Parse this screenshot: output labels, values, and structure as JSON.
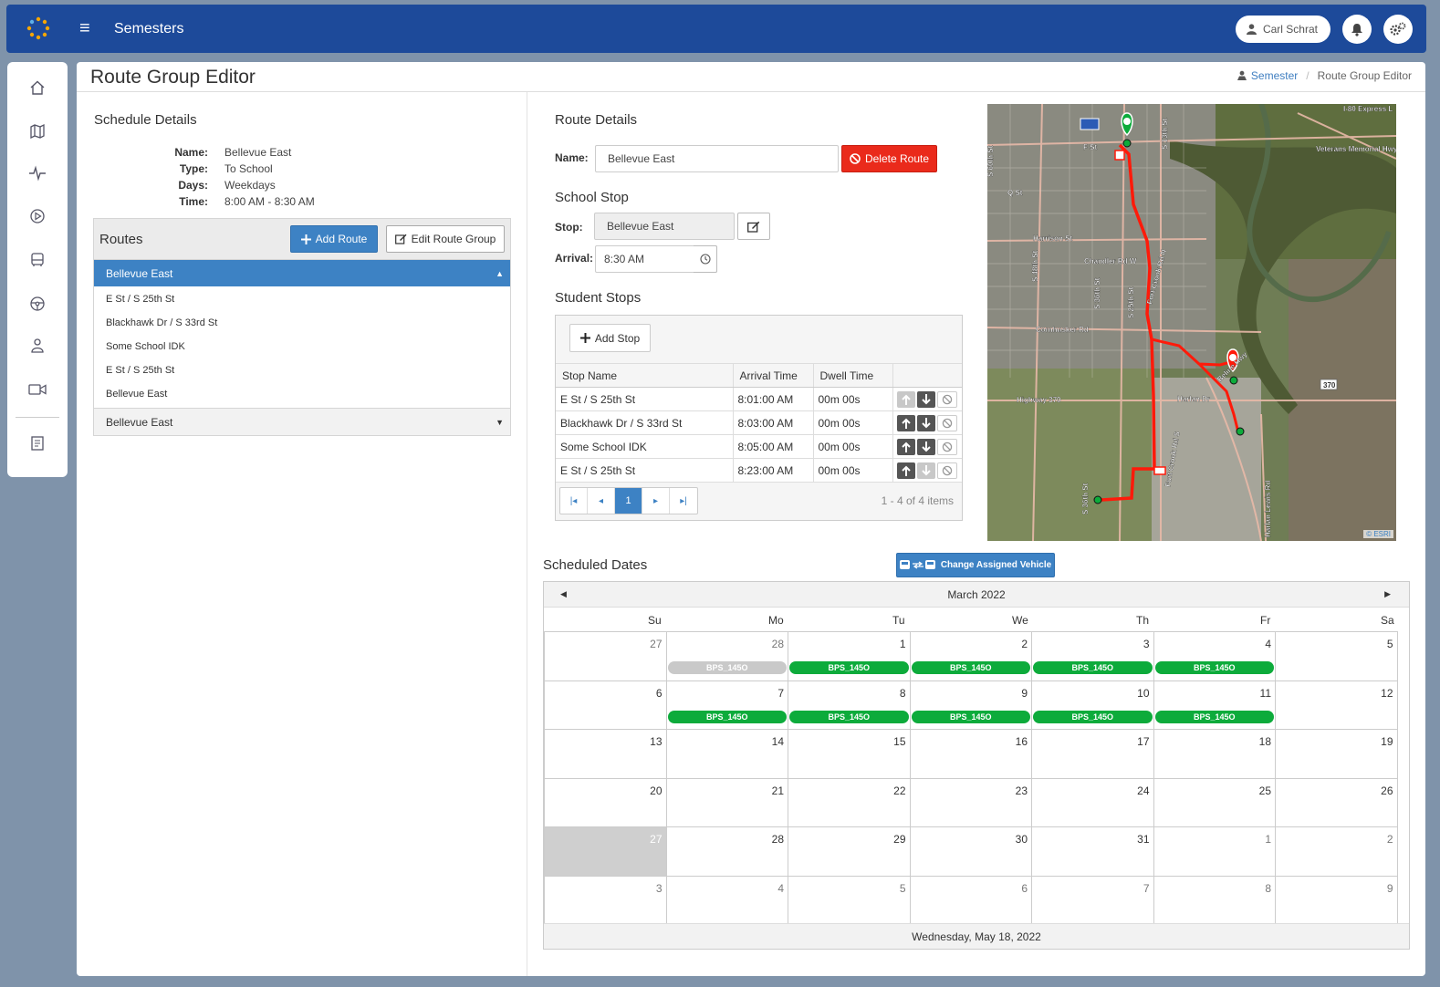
{
  "header": {
    "title": "Semesters",
    "user_name": "Carl Schrat"
  },
  "sidebar": {
    "items": [
      {
        "name": "home-icon"
      },
      {
        "name": "map-icon"
      },
      {
        "name": "activity-icon"
      },
      {
        "name": "play-circle-icon"
      },
      {
        "name": "bus-icon"
      },
      {
        "name": "steering-wheel-icon"
      },
      {
        "name": "person-icon"
      },
      {
        "name": "video-camera-icon"
      },
      {
        "name": "book-icon"
      }
    ]
  },
  "page": {
    "title": "Route Group Editor",
    "breadcrumb": {
      "parent": "Semester",
      "current": "Route Group Editor"
    }
  },
  "schedule": {
    "heading": "Schedule Details",
    "fields": [
      {
        "label": "Name:",
        "value": "Bellevue East"
      },
      {
        "label": "Type:",
        "value": "To School"
      },
      {
        "label": "Days:",
        "value": "Weekdays"
      },
      {
        "label": "Time:",
        "value": "8:00 AM - 8:30 AM"
      }
    ]
  },
  "routes": {
    "heading": "Routes",
    "add_label": "Add Route",
    "edit_label": "Edit Route Group",
    "active_route": "Bellevue East",
    "stops": [
      "E St / S 25th St",
      "Blackhawk Dr / S 33rd St",
      "Some School IDK",
      "E St / S 25th St",
      "Bellevue East"
    ],
    "collapsed_route": "Bellevue East"
  },
  "route_details": {
    "heading": "Route Details",
    "name_label": "Name:",
    "name_value": "Bellevue East",
    "delete_label": "Delete Route"
  },
  "school_stop": {
    "heading": "School Stop",
    "stop_label": "Stop:",
    "stop_value": "Bellevue East",
    "arrival_label": "Arrival:",
    "arrival_value": "8:30 AM"
  },
  "student_stops": {
    "heading": "Student Stops",
    "add_label": "Add Stop",
    "columns": [
      "Stop Name",
      "Arrival Time",
      "Dwell Time"
    ],
    "rows": [
      {
        "name": "E St / S 25th St",
        "arrival": "8:01:00 AM",
        "dwell": "00m 00s",
        "up": false,
        "down": true
      },
      {
        "name": "Blackhawk Dr / S 33rd St",
        "arrival": "8:03:00 AM",
        "dwell": "00m 00s",
        "up": true,
        "down": true
      },
      {
        "name": "Some School IDK",
        "arrival": "8:05:00 AM",
        "dwell": "00m 00s",
        "up": true,
        "down": true
      },
      {
        "name": "E St / S 25th St",
        "arrival": "8:23:00 AM",
        "dwell": "00m 00s",
        "up": true,
        "down": false
      }
    ],
    "page": "1",
    "page_info": "1 - 4 of 4 items"
  },
  "map": {
    "attribution": "© ESRI",
    "labels": [
      "I-80 Express L",
      "F St",
      "Q St",
      "S 60th St",
      "Harrison St",
      "S 48th St",
      "Chandler Rd W",
      "S 36th St",
      "S 25th St",
      "Cornhusker Rd",
      "Highway 370",
      "Harlan Dr",
      "S 36th St",
      "Fort Crook Rd S",
      "Veterans Memorial Hwy",
      "370",
      "Harlan Lewis Rd",
      "S 13th St",
      "Fort Crook Rd N",
      "Beline Hwy"
    ]
  },
  "scheduled": {
    "heading": "Scheduled Dates",
    "change_vehicle_label": "Change Assigned Vehicle",
    "month_label": "March 2022",
    "dow": [
      "Su",
      "Mo",
      "Tu",
      "We",
      "Th",
      "Fr",
      "Sa"
    ],
    "weeks": [
      [
        {
          "d": "27",
          "o": true
        },
        {
          "d": "28",
          "o": true,
          "ev": "BPS_145O",
          "past": true
        },
        {
          "d": "1",
          "ev": "BPS_145O"
        },
        {
          "d": "2",
          "ev": "BPS_145O"
        },
        {
          "d": "3",
          "ev": "BPS_145O"
        },
        {
          "d": "4",
          "ev": "BPS_145O"
        },
        {
          "d": "5"
        }
      ],
      [
        {
          "d": "6"
        },
        {
          "d": "7",
          "ev": "BPS_145O"
        },
        {
          "d": "8",
          "ev": "BPS_145O"
        },
        {
          "d": "9",
          "ev": "BPS_145O"
        },
        {
          "d": "10",
          "ev": "BPS_145O"
        },
        {
          "d": "11",
          "ev": "BPS_145O"
        },
        {
          "d": "12"
        }
      ],
      [
        {
          "d": "13"
        },
        {
          "d": "14"
        },
        {
          "d": "15"
        },
        {
          "d": "16"
        },
        {
          "d": "17"
        },
        {
          "d": "18"
        },
        {
          "d": "19"
        }
      ],
      [
        {
          "d": "20"
        },
        {
          "d": "21"
        },
        {
          "d": "22"
        },
        {
          "d": "23"
        },
        {
          "d": "24"
        },
        {
          "d": "25"
        },
        {
          "d": "26"
        }
      ],
      [
        {
          "d": "27",
          "today": true
        },
        {
          "d": "28"
        },
        {
          "d": "29"
        },
        {
          "d": "30"
        },
        {
          "d": "31"
        },
        {
          "d": "1",
          "o": true
        },
        {
          "d": "2",
          "o": true
        }
      ],
      [
        {
          "d": "3",
          "o": true
        },
        {
          "d": "4",
          "o": true
        },
        {
          "d": "5",
          "o": true
        },
        {
          "d": "6",
          "o": true
        },
        {
          "d": "7",
          "o": true
        },
        {
          "d": "8",
          "o": true
        },
        {
          "d": "9",
          "o": true
        }
      ]
    ],
    "footer_date": "Wednesday, May 18, 2022"
  },
  "colors": {
    "brand": "#1d4a9a",
    "primary": "#3d82c4",
    "danger": "#ea2a1b",
    "event": "#0dab3b",
    "route_line": "#ff1a0a"
  }
}
